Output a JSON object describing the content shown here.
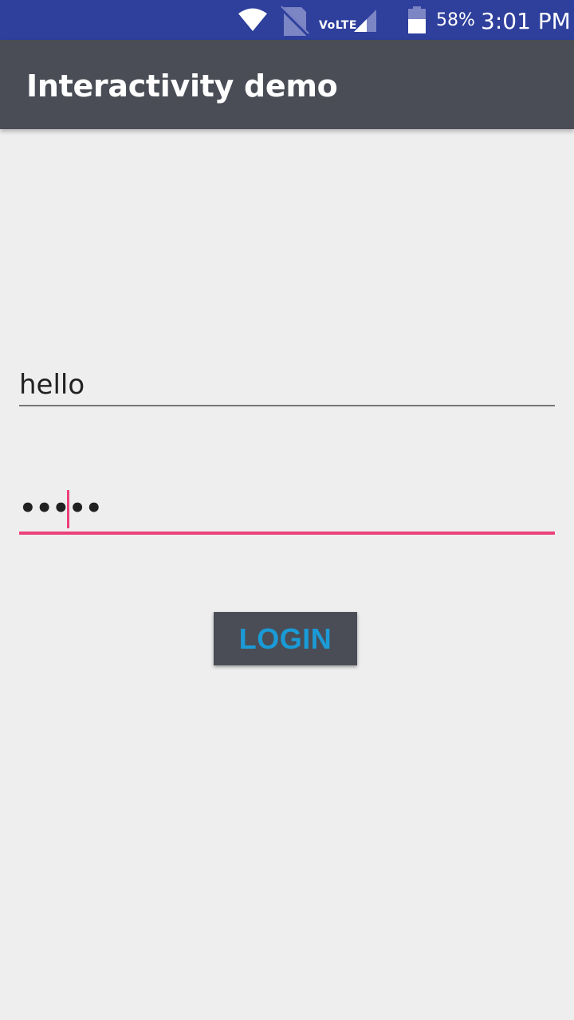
{
  "status_bar": {
    "network_label": "VoLTE",
    "battery_percent": "58%",
    "time": "3:01 PM",
    "icons": [
      "wifi-icon",
      "no-sim-icon",
      "signal-icon",
      "battery-icon"
    ],
    "battery_level": 0.58
  },
  "app_bar": {
    "title": "Interactivity demo"
  },
  "form": {
    "username_value": "hello",
    "password_value": "•••••",
    "login_label": "LOGIN"
  },
  "colors": {
    "status_bar": "#2e3f9c",
    "app_bar": "#4a4d55",
    "background": "#eeeeee",
    "accent": "#ec407a",
    "button_text": "#1a9bd7"
  }
}
